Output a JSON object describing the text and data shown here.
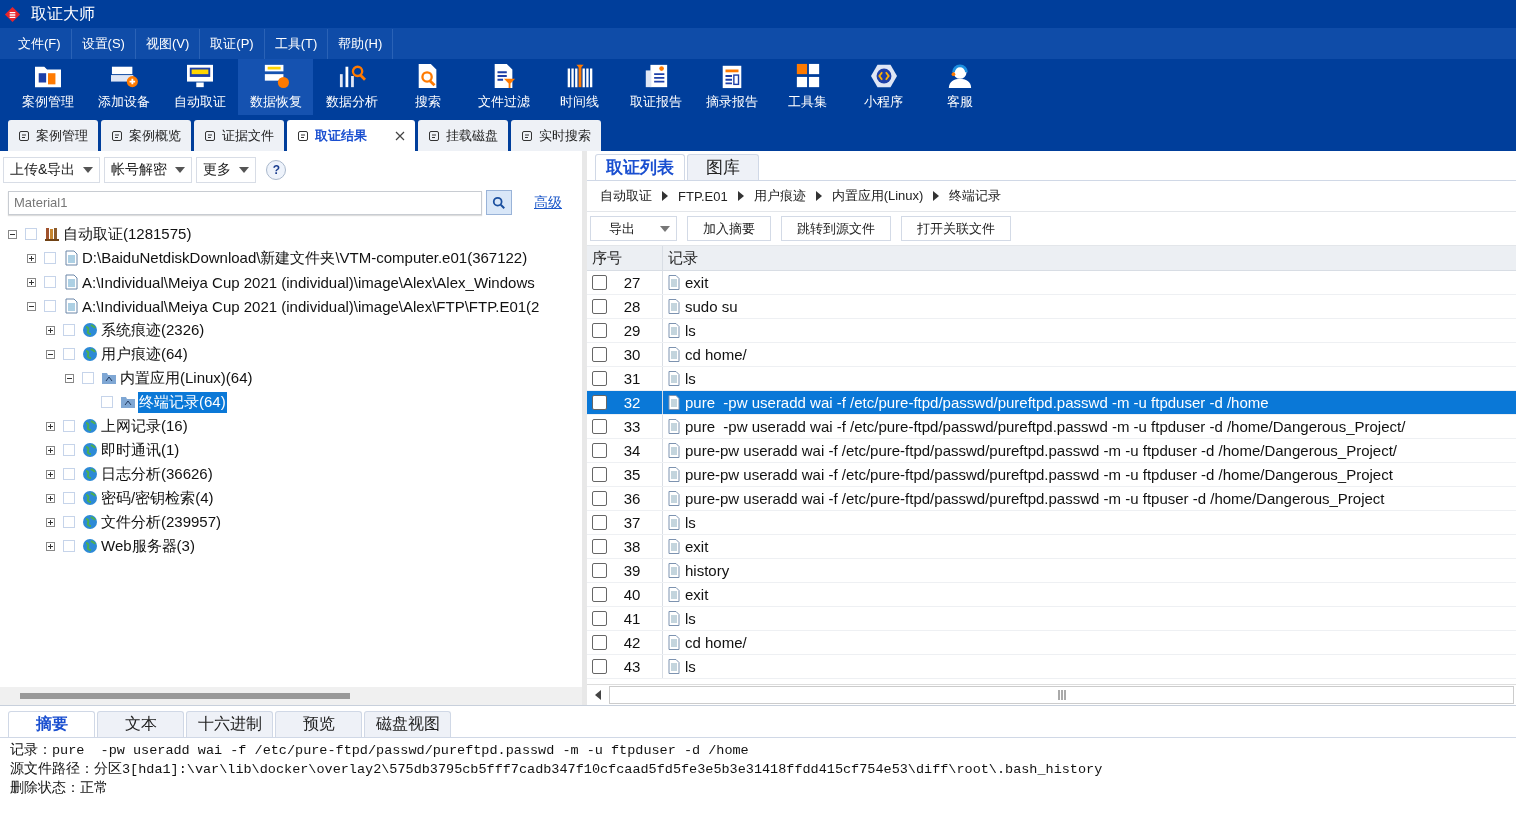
{
  "window": {
    "title": "取证大师"
  },
  "menu": [
    "文件(F)",
    "设置(S)",
    "视图(V)",
    "取证(P)",
    "工具(T)",
    "帮助(H)"
  ],
  "toolbar": [
    {
      "label": "案例管理",
      "selected": false
    },
    {
      "label": "添加设备",
      "selected": false
    },
    {
      "label": "自动取证",
      "selected": false
    },
    {
      "label": "数据恢复",
      "selected": true
    },
    {
      "label": "数据分析",
      "selected": false
    },
    {
      "label": "搜索",
      "selected": false
    },
    {
      "label": "文件过滤",
      "selected": false
    },
    {
      "label": "时间线",
      "selected": false
    },
    {
      "label": "取证报告",
      "selected": false
    },
    {
      "label": "摘录报告",
      "selected": false
    },
    {
      "label": "工具集",
      "selected": false
    },
    {
      "label": "小程序",
      "selected": false
    },
    {
      "label": "客服",
      "selected": false
    }
  ],
  "tabs": [
    {
      "label": "案例管理",
      "selected": false
    },
    {
      "label": "案例概览",
      "selected": false
    },
    {
      "label": "证据文件",
      "selected": false
    },
    {
      "label": "取证结果",
      "selected": true
    },
    {
      "label": "挂载磁盘",
      "selected": false
    },
    {
      "label": "实时搜索",
      "selected": false
    }
  ],
  "left_toolbar": [
    "上传&导出",
    "帐号解密",
    "更多"
  ],
  "help": "?",
  "search": {
    "value": "Material1",
    "link": "高级"
  },
  "tree": [
    {
      "label": "自动取证(1281575)",
      "kind": "root",
      "expanded": true,
      "checked": false,
      "selected": false,
      "children": [
        {
          "label": "D:\\BaiduNetdiskDownload\\新建文件夹\\VTM-computer.e01(367122)",
          "kind": "file",
          "expanded": false,
          "checked": false,
          "selected": false
        },
        {
          "label": "A:\\Individual\\Meiya Cup 2021 (individual)\\image\\Alex\\Alex_Windows",
          "kind": "file",
          "expanded": false,
          "checked": false,
          "selected": false
        },
        {
          "label": "A:\\Individual\\Meiya Cup 2021 (individual)\\image\\Alex\\FTP\\FTP.E01(2",
          "kind": "file",
          "expanded": true,
          "checked": false,
          "selected": false,
          "children": [
            {
              "label": "系统痕迹(2326)",
              "kind": "category",
              "expanded": false,
              "checked": false,
              "selected": false
            },
            {
              "label": "用户痕迹(64)",
              "kind": "category",
              "expanded": true,
              "checked": false,
              "selected": false,
              "children": [
                {
                  "label": "内置应用(Linux)(64)",
                  "kind": "folder",
                  "expanded": true,
                  "checked": false,
                  "selected": false,
                  "children": [
                    {
                      "label": "终端记录(64)",
                      "kind": "folder",
                      "checked": false,
                      "selected": true
                    }
                  ]
                }
              ]
            },
            {
              "label": "上网记录(16)",
              "kind": "category",
              "expanded": false,
              "checked": false,
              "selected": false
            },
            {
              "label": "即时通讯(1)",
              "kind": "category",
              "expanded": false,
              "checked": false,
              "selected": false
            },
            {
              "label": "日志分析(36626)",
              "kind": "category",
              "expanded": false,
              "checked": false,
              "selected": false
            },
            {
              "label": "密码/密钥检索(4)",
              "kind": "category",
              "expanded": false,
              "checked": false,
              "selected": false
            },
            {
              "label": "文件分析(239957)",
              "kind": "category",
              "expanded": false,
              "checked": false,
              "selected": false
            },
            {
              "label": "Web服务器(3)",
              "kind": "category",
              "expanded": false,
              "checked": false,
              "selected": false
            }
          ]
        }
      ]
    }
  ],
  "right_tabs": [
    {
      "label": "取证列表",
      "selected": true
    },
    {
      "label": "图库",
      "selected": false
    }
  ],
  "breadcrumb": [
    "自动取证",
    "FTP.E01",
    "用户痕迹",
    "内置应用(Linux)",
    "终端记录"
  ],
  "actions": [
    {
      "label": "导出",
      "kind": "dropdown"
    },
    {
      "label": "加入摘要",
      "kind": "button"
    },
    {
      "label": "跳转到源文件",
      "kind": "button"
    },
    {
      "label": "打开关联文件",
      "kind": "button"
    }
  ],
  "table": {
    "columns": [
      "序号",
      "记录"
    ],
    "rows": [
      {
        "no": "27",
        "record": "exit",
        "checked": false,
        "selected": false
      },
      {
        "no": "28",
        "record": "sudo su",
        "checked": false,
        "selected": false
      },
      {
        "no": "29",
        "record": "ls",
        "checked": false,
        "selected": false
      },
      {
        "no": "30",
        "record": "cd home/",
        "checked": false,
        "selected": false
      },
      {
        "no": "31",
        "record": "ls",
        "checked": false,
        "selected": false
      },
      {
        "no": "32",
        "record": "pure  -pw useradd wai -f /etc/pure-ftpd/passwd/pureftpd.passwd -m -u ftpduser -d /home",
        "checked": false,
        "selected": true
      },
      {
        "no": "33",
        "record": "pure  -pw useradd wai -f /etc/pure-ftpd/passwd/pureftpd.passwd -m -u ftpduser -d /home/Dangerous_Project/",
        "checked": false,
        "selected": false
      },
      {
        "no": "34",
        "record": "pure-pw useradd wai -f /etc/pure-ftpd/passwd/pureftpd.passwd -m -u ftpduser -d /home/Dangerous_Project/",
        "checked": false,
        "selected": false
      },
      {
        "no": "35",
        "record": "pure-pw useradd wai -f /etc/pure-ftpd/passwd/pureftpd.passwd -m -u ftpduser -d /home/Dangerous_Project",
        "checked": false,
        "selected": false
      },
      {
        "no": "36",
        "record": "pure-pw useradd wai -f /etc/pure-ftpd/passwd/pureftpd.passwd -m -u ftpuser -d /home/Dangerous_Project",
        "checked": false,
        "selected": false
      },
      {
        "no": "37",
        "record": "ls",
        "checked": false,
        "selected": false
      },
      {
        "no": "38",
        "record": "exit",
        "checked": false,
        "selected": false
      },
      {
        "no": "39",
        "record": "history",
        "checked": false,
        "selected": false
      },
      {
        "no": "40",
        "record": "exit",
        "checked": false,
        "selected": false
      },
      {
        "no": "41",
        "record": "ls",
        "checked": false,
        "selected": false
      },
      {
        "no": "42",
        "record": "cd home/",
        "checked": false,
        "selected": false
      },
      {
        "no": "43",
        "record": "ls",
        "checked": false,
        "selected": false
      }
    ]
  },
  "bottom_tabs": [
    {
      "label": "摘要",
      "selected": true
    },
    {
      "label": "文本",
      "selected": false
    },
    {
      "label": "十六进制",
      "selected": false
    },
    {
      "label": "预览",
      "selected": false
    },
    {
      "label": "磁盘视图",
      "selected": false
    }
  ],
  "details": [
    "记录：pure  -pw useradd wai -f /etc/pure-ftpd/passwd/pureftpd.passwd -m -u ftpduser -d /home",
    "源文件路径：分区3[hda1]:\\var\\lib\\docker\\overlay2\\575db3795cb5fff7cadb347f10cfcaad5fd5fe3e5b3e31418ffdd415cf754e53\\diff\\root\\.bash_history",
    "删除状态：正常"
  ]
}
